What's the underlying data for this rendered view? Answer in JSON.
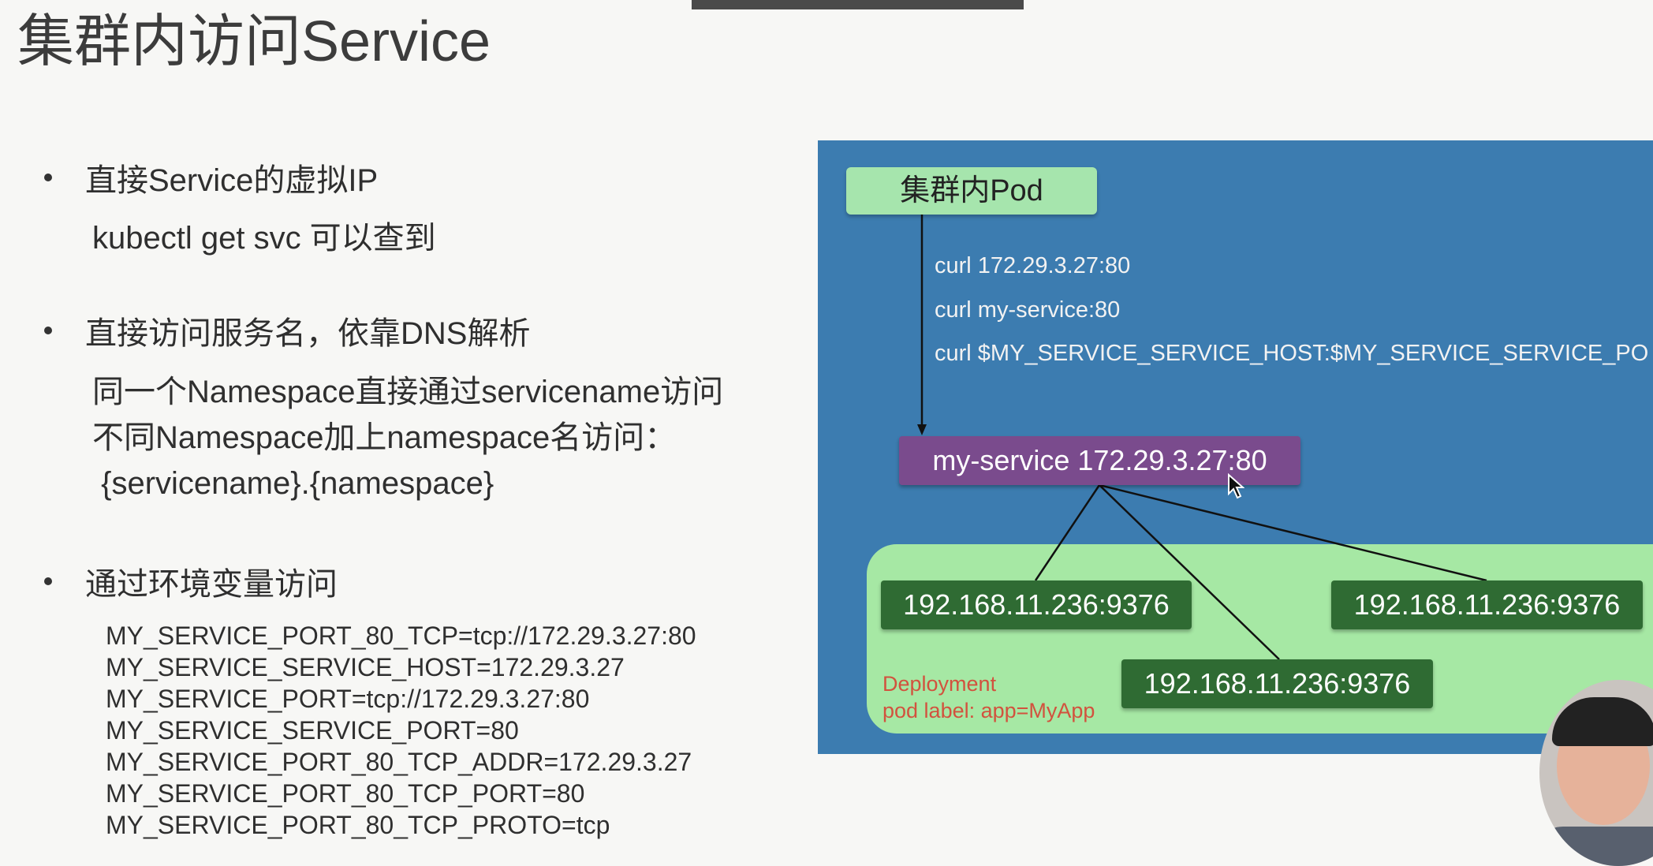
{
  "page": {
    "title": "集群内访问Service"
  },
  "section1": {
    "bullet": "直接Service的虚拟IP",
    "detail": "kubectl get svc 可以查到"
  },
  "section2": {
    "bullet": "直接访问服务名，依靠DNS解析",
    "lines": [
      "同一个Namespace直接通过servicename访问",
      "不同Namespace加上namespace名访问：",
      " {servicename}.{namespace}"
    ]
  },
  "section3": {
    "bullet": "通过环境变量访问",
    "env_vars": [
      "MY_SERVICE_PORT_80_TCP=tcp://172.29.3.27:80",
      "MY_SERVICE_SERVICE_HOST=172.29.3.27",
      "MY_SERVICE_PORT=tcp://172.29.3.27:80",
      "MY_SERVICE_SERVICE_PORT=80",
      "MY_SERVICE_PORT_80_TCP_ADDR=172.29.3.27",
      "MY_SERVICE_PORT_80_TCP_PORT=80",
      "MY_SERVICE_PORT_80_TCP_PROTO=tcp"
    ]
  },
  "diagram": {
    "pod_label": "集群内Pod",
    "curls": [
      "curl 172.29.3.27:80",
      "curl my-service:80",
      "curl $MY_SERVICE_SERVICE_HOST:$MY_SERVICE_SERVICE_PO"
    ],
    "service_label": "my-service 172.29.3.27:80",
    "pods": [
      "192.168.11.236:9376",
      "192.168.11.236:9376",
      "192.168.11.236:9376"
    ],
    "deployment_title": "Deployment",
    "deployment_label": "pod label: app=MyApp"
  },
  "colors": {
    "diagram_bg": "#3c7cb0",
    "pod_box": "#a6e5ad",
    "service_box": "#7a4b8d",
    "deployment_bg": "#a6e8a4",
    "pod_ip_box": "#2f6b33",
    "deployment_text": "#d2523e"
  },
  "icons": {
    "cursor": "mouse-pointer-icon"
  }
}
